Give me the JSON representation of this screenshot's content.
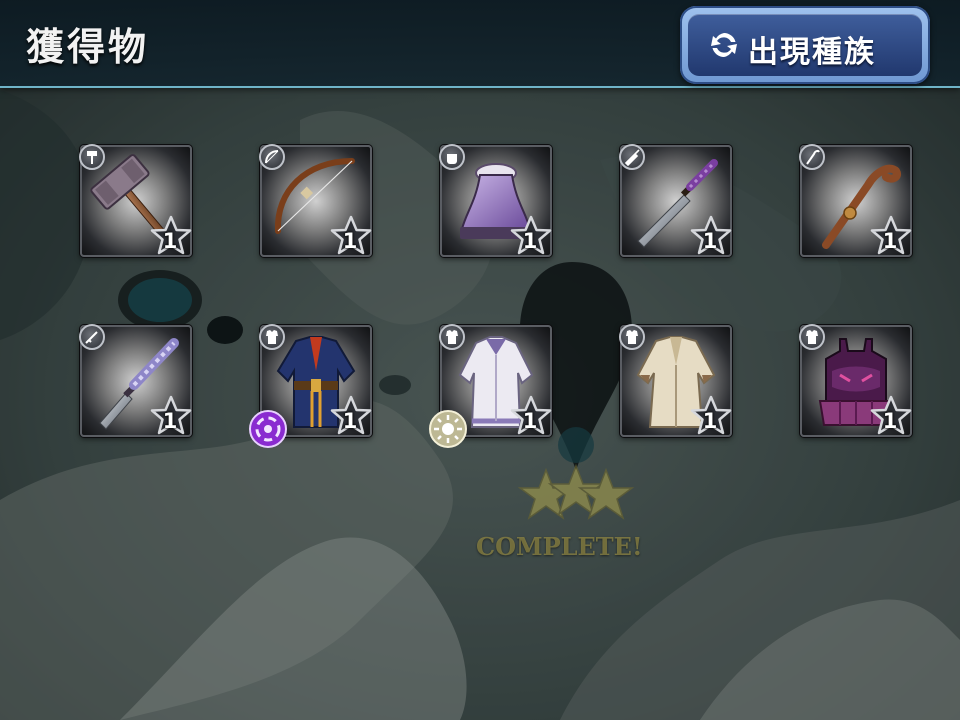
{
  "header": {
    "title": "獲得物",
    "species_button_label": "出現種族",
    "species_button_icon": "refresh-icon"
  },
  "stage": {
    "complete_label": "COMPLETE!",
    "stars": 3
  },
  "items": [
    {
      "name": "hammer",
      "type_icon": "hammer-icon",
      "count": "1",
      "rarity": 1
    },
    {
      "name": "bow",
      "type_icon": "bow-icon",
      "count": "1",
      "rarity": 1
    },
    {
      "name": "gauntlet",
      "type_icon": "fist-icon",
      "count": "1",
      "rarity": 1
    },
    {
      "name": "dagger",
      "type_icon": "dagger-icon",
      "count": "1",
      "rarity": 1
    },
    {
      "name": "staff",
      "type_icon": "staff-icon",
      "count": "1",
      "rarity": 1
    },
    {
      "name": "sword",
      "type_icon": "sword-icon",
      "count": "1",
      "rarity": 1
    },
    {
      "name": "blue-robe",
      "type_icon": "armor-icon",
      "count": "1",
      "rarity": 1,
      "element": "dark"
    },
    {
      "name": "white-robe",
      "type_icon": "armor-icon",
      "count": "1",
      "rarity": 1,
      "element": "light"
    },
    {
      "name": "beige-coat",
      "type_icon": "armor-icon",
      "count": "1",
      "rarity": 1
    },
    {
      "name": "purple-armor",
      "type_icon": "armor-icon",
      "count": "1",
      "rarity": 1
    }
  ],
  "colors": {
    "header_border": "#6fb4c8",
    "button_blue": "#21386e",
    "dark_element": "#8a2bd0",
    "light_element": "#d8d4b0"
  }
}
